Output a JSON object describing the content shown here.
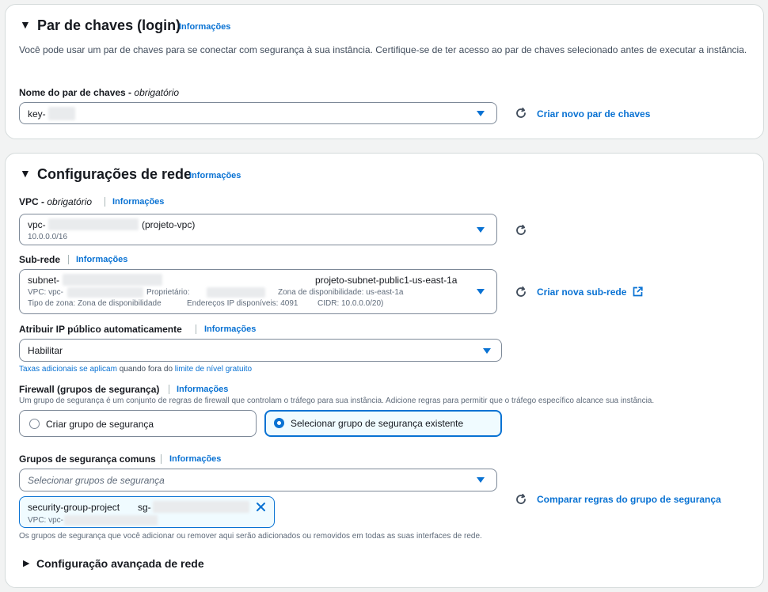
{
  "keypair": {
    "title": "Par de chaves (login)",
    "info": "Informações",
    "description": "Você pode usar um par de chaves para se conectar com segurança à sua instância. Certifique-se de ter acesso ao par de chaves selecionado antes de executar a instância.",
    "name_label": "Nome do par de chaves - ",
    "name_required": "obrigatório",
    "name_value": "key-",
    "create_link": "Criar novo par de chaves"
  },
  "network": {
    "title": "Configurações de rede",
    "info": "Informações",
    "vpc": {
      "label": "VPC - ",
      "required": "obrigatório",
      "info": "Informações",
      "value_prefix": "vpc-",
      "value_name": "(projeto-vpc)",
      "cidr": "10.0.0.0/16"
    },
    "subnet": {
      "label": "Sub-rede",
      "info": "Informações",
      "value_prefix": "subnet-",
      "value_name": "projeto-subnet-public1-us-east-1a",
      "vpc_text": "VPC: vpc-",
      "owner_text": "Proprietário:",
      "az_text": "Zona de disponibilidade: us-east-1a",
      "zone_type_text": "Tipo de zona: Zona de disponibilidade",
      "ips_text": "Endereços IP disponíveis: 4091",
      "cidr_text": "CIDR: 10.0.0.0/20)",
      "create_link": "Criar nova sub-rede"
    },
    "public_ip": {
      "label": "Atribuir IP público automaticamente",
      "info": "Informações",
      "value": "Habilitar",
      "fees_link": "Taxas adicionais se aplicam",
      "fees_mid": " quando fora do ",
      "free_tier_link": "limite de nível gratuito"
    },
    "firewall": {
      "label": "Firewall (grupos de segurança)",
      "info": "Informações",
      "description": "Um grupo de segurança é um conjunto de regras de firewall que controlam o tráfego para sua instância. Adicione regras para permitir que o tráfego específico alcance sua instância.",
      "option_create": "Criar grupo de segurança",
      "option_select": "Selecionar grupo de segurança existente",
      "selected": "Selecionar grupo de segurança existente"
    },
    "common_groups": {
      "label": "Grupos de segurança comuns",
      "info": "Informações",
      "placeholder": "Selecionar grupos de segurança",
      "chip_name": "security-group-project",
      "chip_id_prefix": "sg-",
      "chip_vpc_prefix": "VPC: vpc-",
      "compare_link": "Comparar regras do grupo de segurança",
      "note": "Os grupos de segurança que você adicionar ou remover aqui serão adicionados ou removidos em todas as suas interfaces de rede."
    },
    "advanced": {
      "label": "Configuração avançada de rede"
    }
  },
  "icons": {
    "expanded": "caret-down-icon",
    "collapsed": "caret-right-icon",
    "dropdown": "dropdown-arrow-icon",
    "refresh": "refresh-icon",
    "external": "external-link-icon",
    "remove": "close-icon"
  },
  "colors": {
    "link": "#0972d3",
    "text": "#16191f",
    "border": "#7d8998",
    "selected_bg": "#f0fbff"
  }
}
